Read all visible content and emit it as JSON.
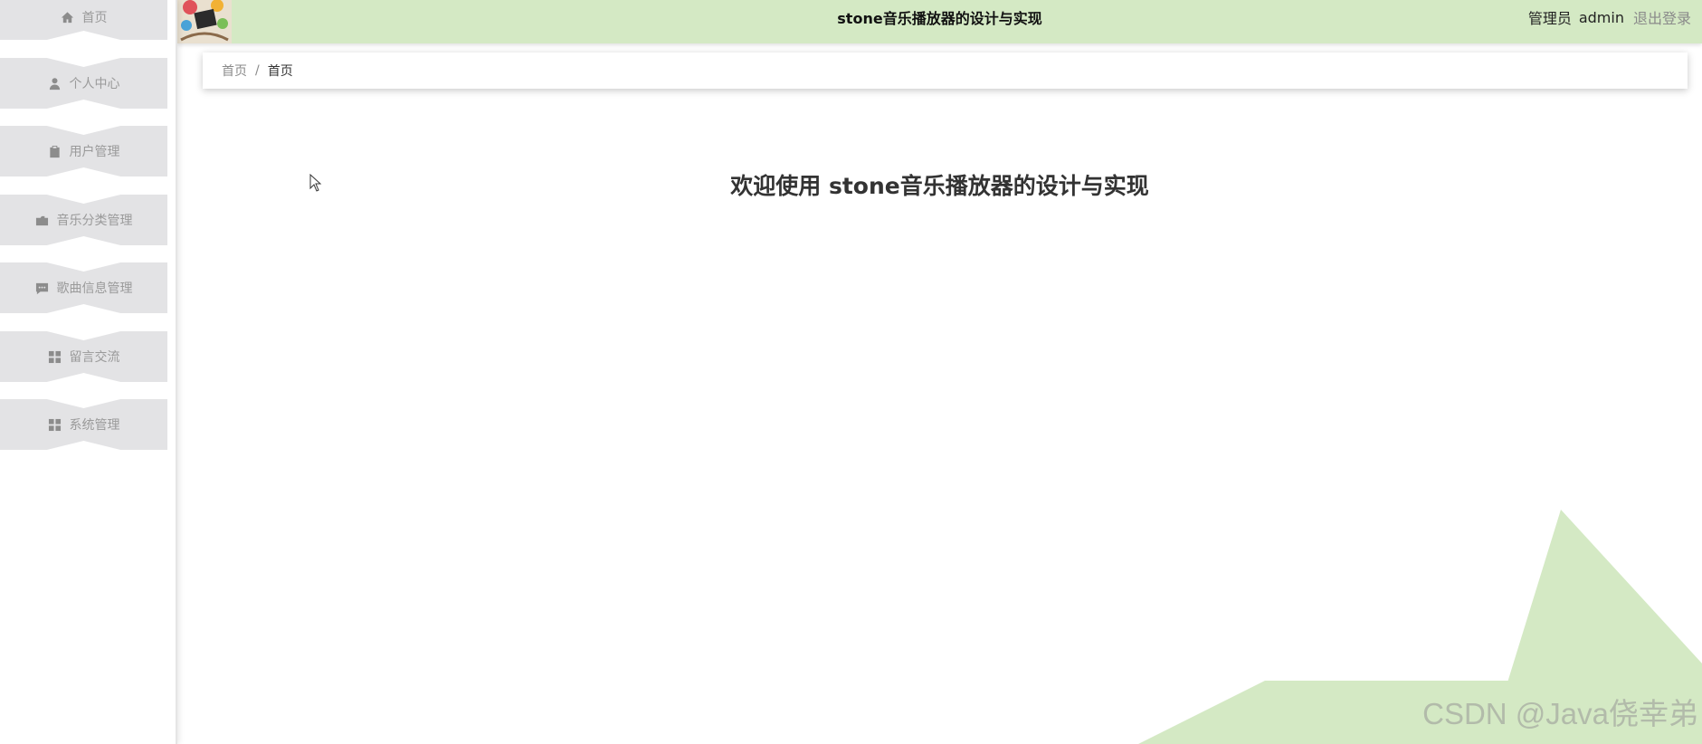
{
  "app": {
    "title": "stone音乐播放器的设计与实现",
    "role": "管理员",
    "username": "admin",
    "logout": "退出登录"
  },
  "sidebar": {
    "items": [
      {
        "label": "首页",
        "icon": "home-icon"
      },
      {
        "label": "个人中心",
        "icon": "user-icon"
      },
      {
        "label": "用户管理",
        "icon": "clipboard-icon"
      },
      {
        "label": "音乐分类管理",
        "icon": "folder-icon"
      },
      {
        "label": "歌曲信息管理",
        "icon": "message-icon"
      },
      {
        "label": "留言交流",
        "icon": "grid-icon"
      },
      {
        "label": "系统管理",
        "icon": "grid-icon"
      }
    ]
  },
  "breadcrumb": {
    "home": "首页",
    "separator": "/",
    "current": "首页"
  },
  "main": {
    "welcome": "欢迎使用 stone音乐播放器的设计与实现"
  },
  "watermark": "CSDN @Java侥幸弟",
  "colors": {
    "header_bg": "#d4e9c4",
    "accent_green": "#d4e9c4",
    "sidebar_item_bg": "#e3e3e5"
  }
}
